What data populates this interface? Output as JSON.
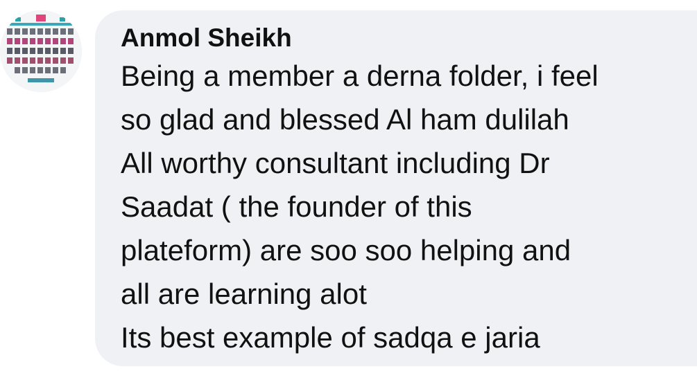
{
  "comment": {
    "author": "Anmol Sheikh",
    "lines": [
      "Being a member a derna folder, i feel",
      "so glad and blessed Al ham dulilah",
      "All worthy consultant including Dr",
      "Saadat ( the founder of this",
      "plateform) are soo soo helping and",
      "all are learning alot",
      "Its best example of sadqa e jaria"
    ]
  },
  "colors": {
    "bubble": "#eff1f4",
    "text": "#111111"
  },
  "icons": {
    "avatar": "profile-collage-avatar"
  }
}
